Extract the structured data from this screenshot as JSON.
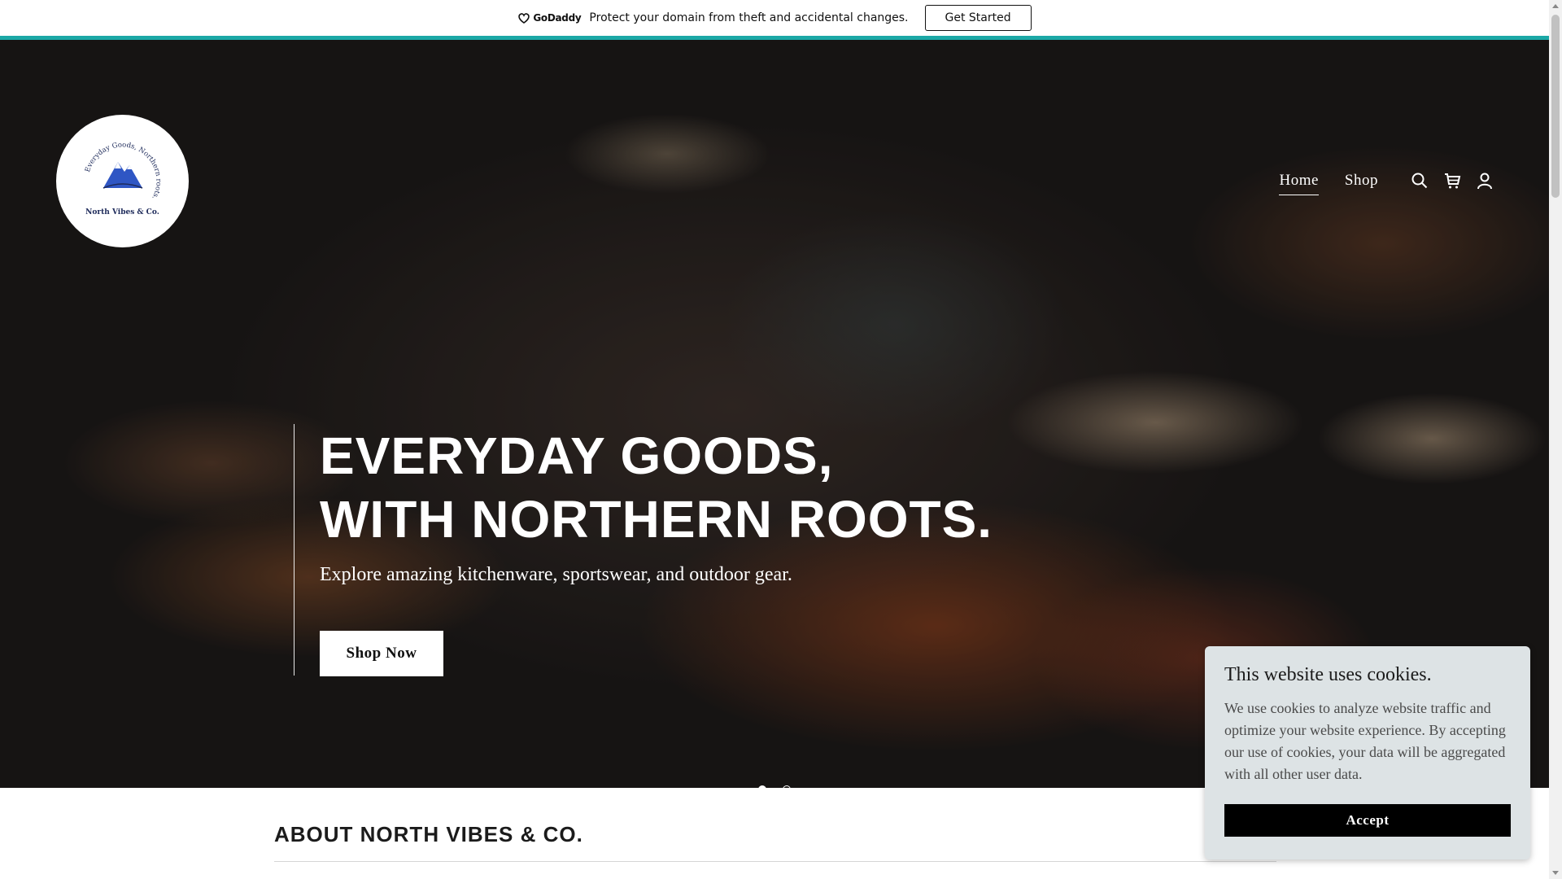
{
  "promo": {
    "brand": "GoDaddy",
    "message": "Protect your domain from theft and accidental changes.",
    "cta": "Get Started",
    "accent_color": "#1ba8a6"
  },
  "logo": {
    "name": "North Vibes & Co.",
    "ring_text": "Everyday Goods, Northern roots."
  },
  "nav": {
    "items": [
      "Home",
      "Shop"
    ],
    "active": "Home",
    "icons": [
      "search-icon",
      "cart-icon",
      "account-icon"
    ]
  },
  "hero": {
    "title_line1": "EVERYDAY GOODS,",
    "title_line2": "WITH NORTHERN ROOTS.",
    "subtitle": "Explore amazing kitchenware, sportswear, and outdoor gear.",
    "cta": "Shop Now",
    "slides": 2,
    "active_slide": 1
  },
  "about": {
    "title": "ABOUT NORTH VIBES & CO."
  },
  "cookie": {
    "title": "This website uses cookies.",
    "text": "We use cookies to analyze website traffic and optimize your website experience. By accepting our use of cookies, your data will be aggregated with all other user data.",
    "accept": "Accept",
    "background": "#dde3e5"
  }
}
